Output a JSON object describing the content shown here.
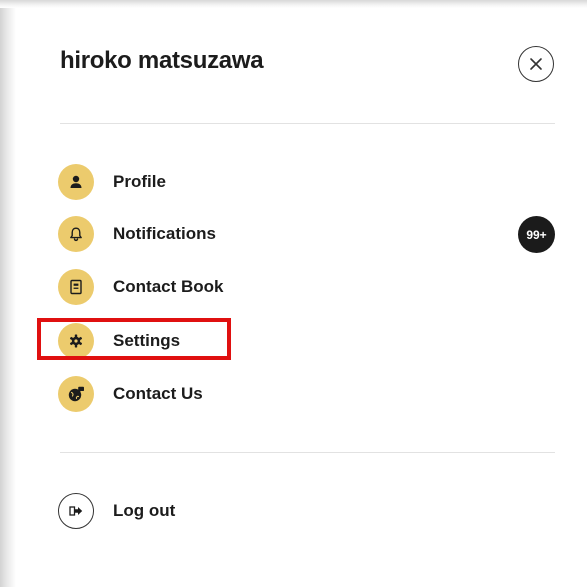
{
  "user": {
    "name": "hiroko matsuzawa"
  },
  "menu": [
    {
      "label": "Profile",
      "icon": "person-icon"
    },
    {
      "label": "Notifications",
      "icon": "bell-icon",
      "badge": "99+"
    },
    {
      "label": "Contact Book",
      "icon": "contact-book-icon"
    },
    {
      "label": "Settings",
      "icon": "gear-icon",
      "highlighted": true
    },
    {
      "label": "Contact Us",
      "icon": "globe-chat-icon"
    }
  ],
  "logout": {
    "label": "Log out",
    "icon": "logout-icon"
  },
  "colors": {
    "icon_circle": "#eccb6d",
    "badge_bg": "#1b1b1b",
    "highlight_border": "#e01010",
    "text": "#1c1c1c"
  }
}
